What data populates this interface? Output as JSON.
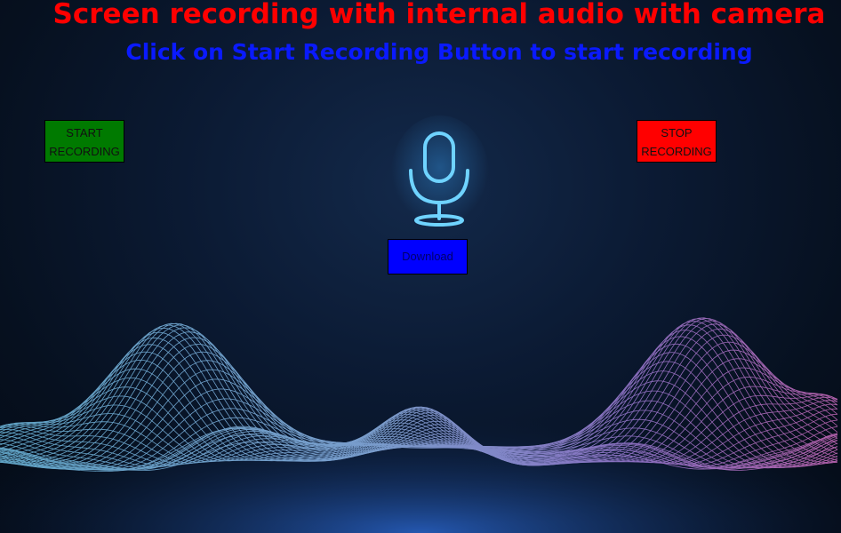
{
  "header": {
    "title": "Screen recording with internal audio with camera",
    "subtitle": "Click on Start Recording Button to start recording"
  },
  "controls": {
    "start_label_line1": "START",
    "start_label_line2": "RECORDING",
    "stop_label_line1": "STOP",
    "stop_label_line2": "RECORDING",
    "download_label": "Download"
  },
  "icons": {
    "center": "microphone-icon",
    "background": "sound-wave-graphic"
  },
  "colors": {
    "title": "#ff0000",
    "subtitle": "#0a1aff",
    "start_button": "#007a00",
    "stop_button": "#ff0000",
    "download_button": "#0000ff",
    "mic_glow": "#5fd0ff"
  }
}
